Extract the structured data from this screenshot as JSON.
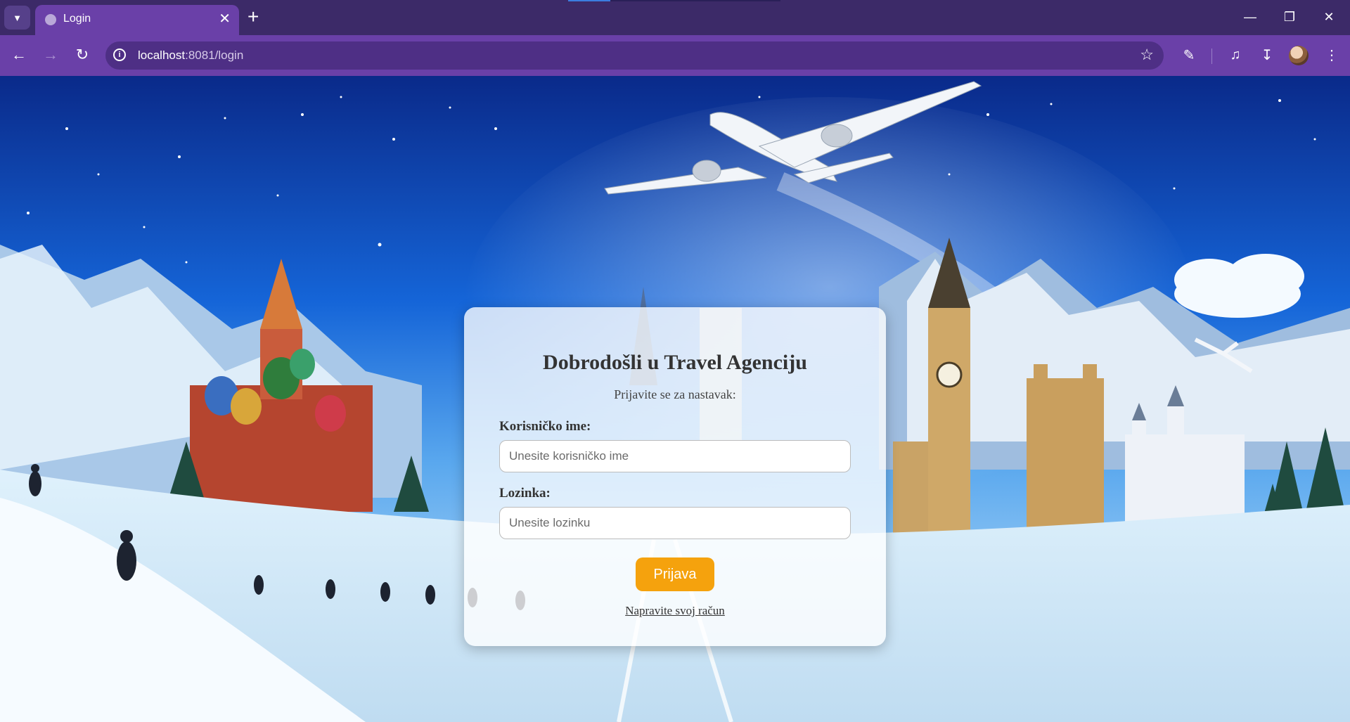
{
  "browser": {
    "tab_title": "Login",
    "url_host": "localhost",
    "url_path": ":8081/login",
    "accent_color": "#6a40a8",
    "tabbar_color": "#3c2a68"
  },
  "login": {
    "title": "Dobrodošli u Travel Agenciju",
    "subtitle": "Prijavite se za nastavak:",
    "username_label": "Korisničko ime:",
    "username_placeholder": "Unesite korisničko ime",
    "username_value": "",
    "password_label": "Lozinka:",
    "password_placeholder": "Unesite lozinku",
    "password_value": "",
    "submit_label": "Prijava",
    "register_link": "Napravite svoj račun",
    "button_color": "#f5a20d"
  }
}
